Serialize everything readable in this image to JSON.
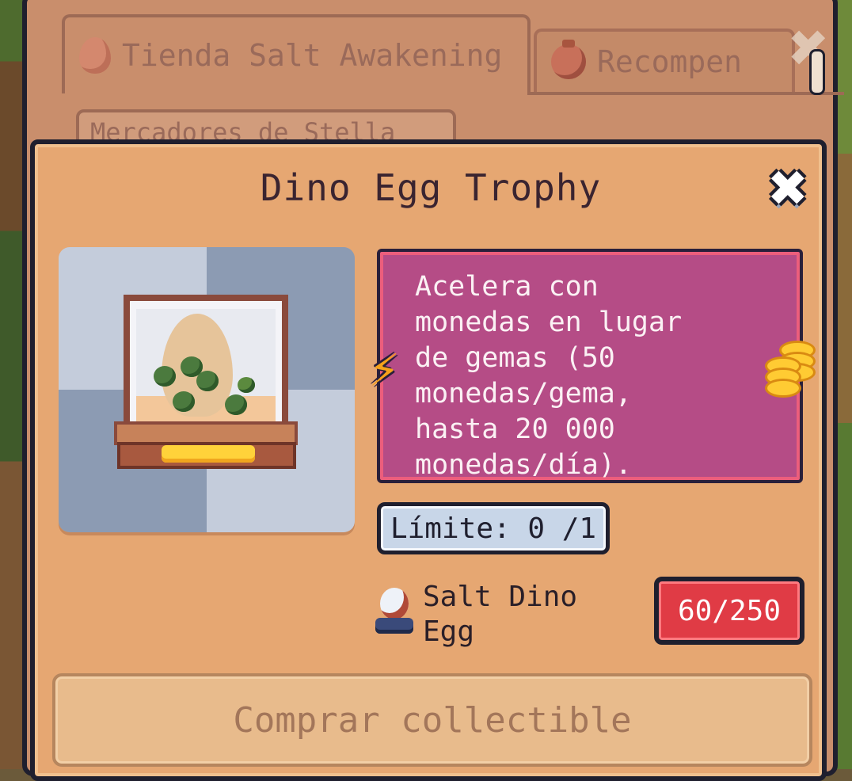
{
  "shop": {
    "tabs": [
      {
        "label": "Tienda Salt Awakening",
        "active": true,
        "icon": "egg-icon"
      },
      {
        "label": "Recompen",
        "active": false,
        "icon": "reward-bag-icon"
      }
    ],
    "category_tab_label": "Mercadores de Stella"
  },
  "modal": {
    "title": "Dino Egg Trophy",
    "description": "Acelera con\nmonedas en lugar\nde gemas (50\nmonedas/gema,\nhasta 20 000\nmonedas/día).",
    "limit_text": "Límite: 0 /1",
    "requirement": {
      "name": "Salt Dino\nEgg",
      "count": "60/250",
      "icon": "salt-dino-egg-icon"
    },
    "buy_button_label": "Comprar collectible",
    "colors": {
      "modal_bg": "#e6a772",
      "description_bg": "#b54c86",
      "requirement_badge": "#e03b45",
      "buy_button_disabled": "#e8bb8c"
    }
  }
}
